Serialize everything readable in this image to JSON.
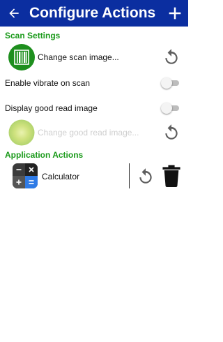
{
  "header": {
    "title": "Configure Actions",
    "background": "#0b2ea0"
  },
  "scan_settings": {
    "section_title": "Scan Settings",
    "change_scan_image_label": "Change scan image...",
    "vibrate_label": "Enable vibrate on scan",
    "vibrate_enabled": false,
    "good_read_label": "Display good read image",
    "good_read_enabled": false,
    "change_good_read_label": "Change good read image..."
  },
  "application_actions": {
    "section_title": "Application Actions",
    "items": [
      {
        "label": "Calculator",
        "icon": "calculator-icon"
      }
    ]
  },
  "colors": {
    "accent": "#1a9a1a",
    "appbar": "#0b2ea0"
  }
}
